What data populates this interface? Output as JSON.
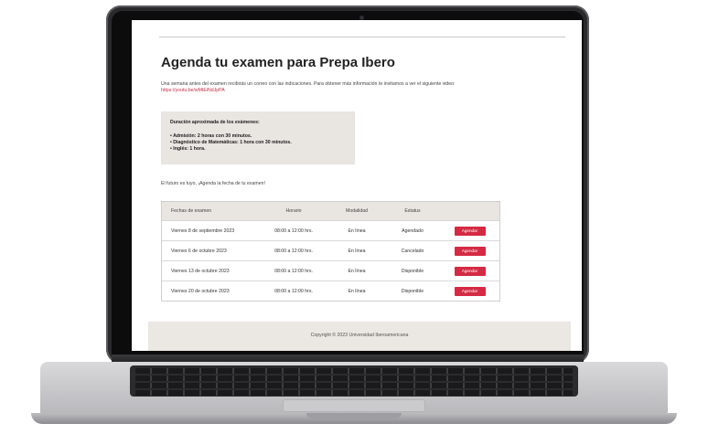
{
  "page": {
    "title": "Agenda tu examen para Prepa Ibero",
    "intro": "Una semana antes del examen recibirás un correo con las indicaciones. Para obtener más información te invitamos a ver el siguiente video:",
    "video_link": "https://youtu.be/wMtEiNdJpPA",
    "info_box": {
      "heading": "Duración aproximada de los exámenes:",
      "items": [
        "• Admisión: 2 horas con 30 minutos.",
        "• Diagnóstico de Matemáticas: 1 hora con 30 minutos.",
        "• Inglés: 1 hora."
      ]
    },
    "cta": "El futuro es tuyo, ¡Agenda la fecha de tu examen!",
    "table": {
      "headers": [
        "Fechas de examen",
        "Horario",
        "Modalidad",
        "Estatus",
        ""
      ],
      "rows": [
        {
          "date": "Viernes 8 de septiembre 2023",
          "time": "08:00 a 12:00 hrs.",
          "mode": "En línea",
          "status": "Agendado",
          "action": "Agendar"
        },
        {
          "date": "Viernes 6 de octubre 2023",
          "time": "08:00 a 12:00 hrs.",
          "mode": "En línea",
          "status": "Cancelado",
          "action": "Agendar"
        },
        {
          "date": "Viernes 13 de octubre 2023",
          "time": "08:00 a 12:00 hrs.",
          "mode": "En línea",
          "status": "Disponible",
          "action": "Agendar"
        },
        {
          "date": "Viernes 20 de octubre 2023",
          "time": "08:00 a 12:00 hrs.",
          "mode": "En línea",
          "status": "Disponible",
          "action": "Agendar"
        }
      ]
    },
    "footer": "Copyright © 2023 Universidad Iberoamericana"
  },
  "colors": {
    "accent": "#d42a43",
    "panel": "#e9e5e1"
  }
}
